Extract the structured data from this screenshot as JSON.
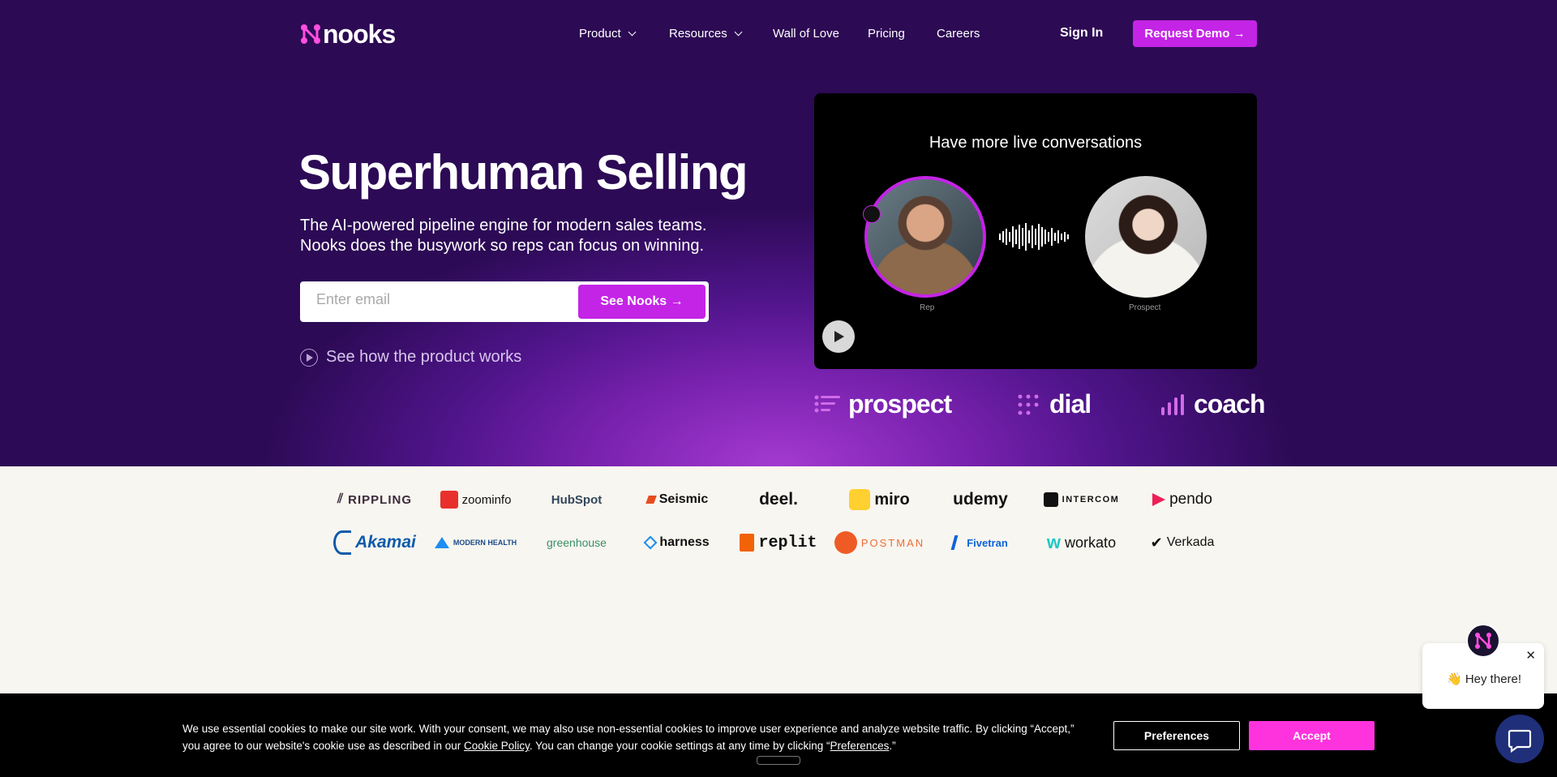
{
  "brand": {
    "name": "nooks",
    "accent": "#c424e6",
    "hero_bg": "#4f148a"
  },
  "nav": {
    "items": [
      {
        "label": "Product",
        "has_dropdown": true
      },
      {
        "label": "Resources",
        "has_dropdown": true
      },
      {
        "label": "Wall of Love"
      },
      {
        "label": "Pricing"
      },
      {
        "label": "Careers"
      }
    ],
    "sign_in": "Sign In",
    "request_demo": "Request Demo →"
  },
  "hero": {
    "headline": "Superhuman Selling",
    "subtitle_line1": "The AI-powered pipeline engine for modern sales teams.",
    "subtitle_line2": "Nooks does the busywork so reps can focus on winning.",
    "email_placeholder": "Enter email",
    "cta": "See Nooks →",
    "how_link": "See how the product works"
  },
  "video": {
    "title": "Have more live conversations",
    "rep_label": "Rep",
    "prospect_label": "Prospect"
  },
  "features": [
    "prospect",
    "dial",
    "coach"
  ],
  "customer_logos": {
    "row1": [
      "RIPPLING",
      "zoominfo",
      "HubSpot",
      "Seismic",
      "deel.",
      "miro",
      "udemy",
      "INTERCOM",
      "pendo"
    ],
    "row2": [
      "Akamai",
      "MODERN HEALTH",
      "greenhouse",
      "harness",
      "replit",
      "POSTMAN",
      "Fivetran",
      "workato",
      "Verkada"
    ]
  },
  "cookie": {
    "text_part1": "We use essential cookies to make our site work. With your consent, we may also use non-essential cookies to improve user experience and analyze website traffic. By clicking “Accept,” you agree to our website's cookie use as described in our ",
    "policy_link": "Cookie Policy",
    "text_part2": ". You can change your cookie settings at any time by clicking “",
    "pref_link": "Preferences",
    "text_part3": ".”",
    "preferences_button": "Preferences",
    "accept_button": "Accept"
  },
  "chat": {
    "greeting": "👋 Hey there!",
    "close": "✕"
  }
}
